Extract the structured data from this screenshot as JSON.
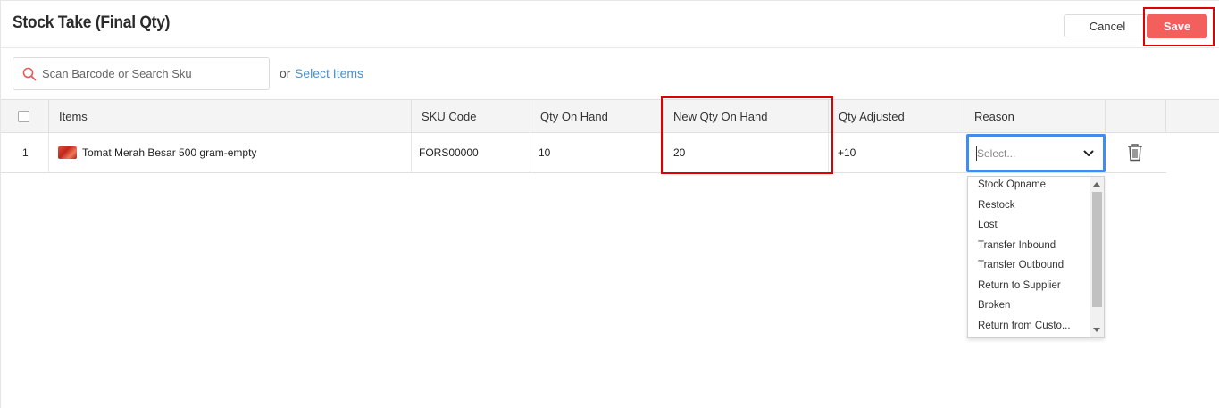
{
  "header": {
    "title": "Stock Take (Final Qty)",
    "cancel_label": "Cancel",
    "save_label": "Save"
  },
  "search": {
    "placeholder": "Scan Barcode or Search Sku",
    "or_text": "or",
    "select_items_label": "Select Items"
  },
  "table": {
    "columns": [
      "Items",
      "SKU Code",
      "Qty On Hand",
      "New Qty On Hand",
      "Qty Adjusted",
      "Reason"
    ],
    "rows": [
      {
        "index": "1",
        "item": "Tomat Merah Besar 500 gram-empty",
        "sku": "FORS00000",
        "qty_on_hand": "10",
        "new_qty_on_hand": "20",
        "qty_adjusted": "+10",
        "reason_placeholder": "Select..."
      }
    ]
  },
  "reason_dropdown": {
    "options": [
      "Stock Opname",
      "Restock",
      "Lost",
      "Transfer Inbound",
      "Transfer Outbound",
      "Return to Supplier",
      "Broken",
      "Return from Custo..."
    ]
  },
  "colors": {
    "accent_save": "#f25f5c",
    "link": "#4a90c8",
    "focus_border": "#3d8ef0",
    "highlight_box": "#e00000"
  }
}
